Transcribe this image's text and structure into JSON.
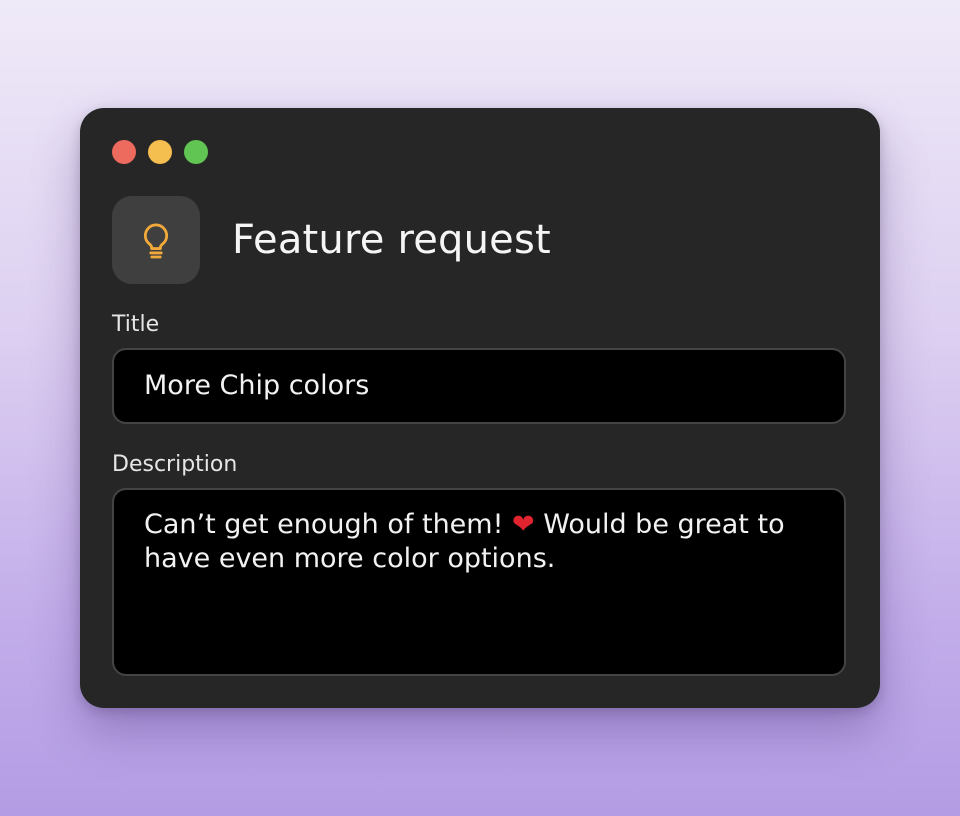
{
  "window": {
    "traffic_lights": [
      "close",
      "minimize",
      "zoom"
    ]
  },
  "header": {
    "icon": "lightbulb-icon",
    "title": "Feature request"
  },
  "form": {
    "title_label": "Title",
    "title_value": "More Chip colors",
    "description_label": "Description",
    "description_value_part1": "Can’t get enough of them! ",
    "description_emoji": "❤",
    "description_value_part2": " Would be great to have even more color options."
  },
  "colors": {
    "icon_accent": "#f2a93b",
    "window_bg": "#262626",
    "input_bg": "#000000"
  }
}
